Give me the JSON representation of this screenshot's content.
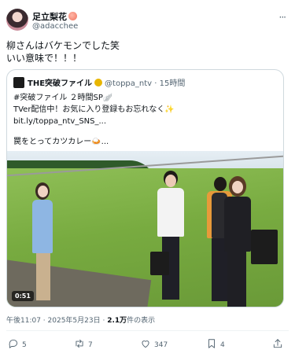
{
  "post": {
    "author_name": "足立梨花",
    "author_handle": "@adacchee",
    "more_label": "···",
    "text_lines": [
      "柳さんはバケモンでした笑",
      "いい意味で！！！"
    ],
    "timestamp": "午後11:07 · 2025年5月23日 · ",
    "views_count": "2.1万",
    "views_label": "件の表示"
  },
  "quote": {
    "author_name": "THE突破ファイル",
    "author_handle": "@toppa_ntv",
    "time_ago": "15時間",
    "lines": [
      "#突破ファイル ２時間SP🪽",
      "TVer配信中！お気に入り登録もお忘れなく✨",
      "bit.ly/toppa_ntv_SNS_...",
      "",
      "罠をとってカツカレー🍛..."
    ],
    "video_time": "0:51"
  },
  "actions": {
    "reply_count": "5",
    "repost_count": "7",
    "like_count": "347",
    "bookmark_count": "4"
  },
  "colors": {
    "text": "#0f1419",
    "muted": "#536471",
    "border": "#cfd9de"
  }
}
